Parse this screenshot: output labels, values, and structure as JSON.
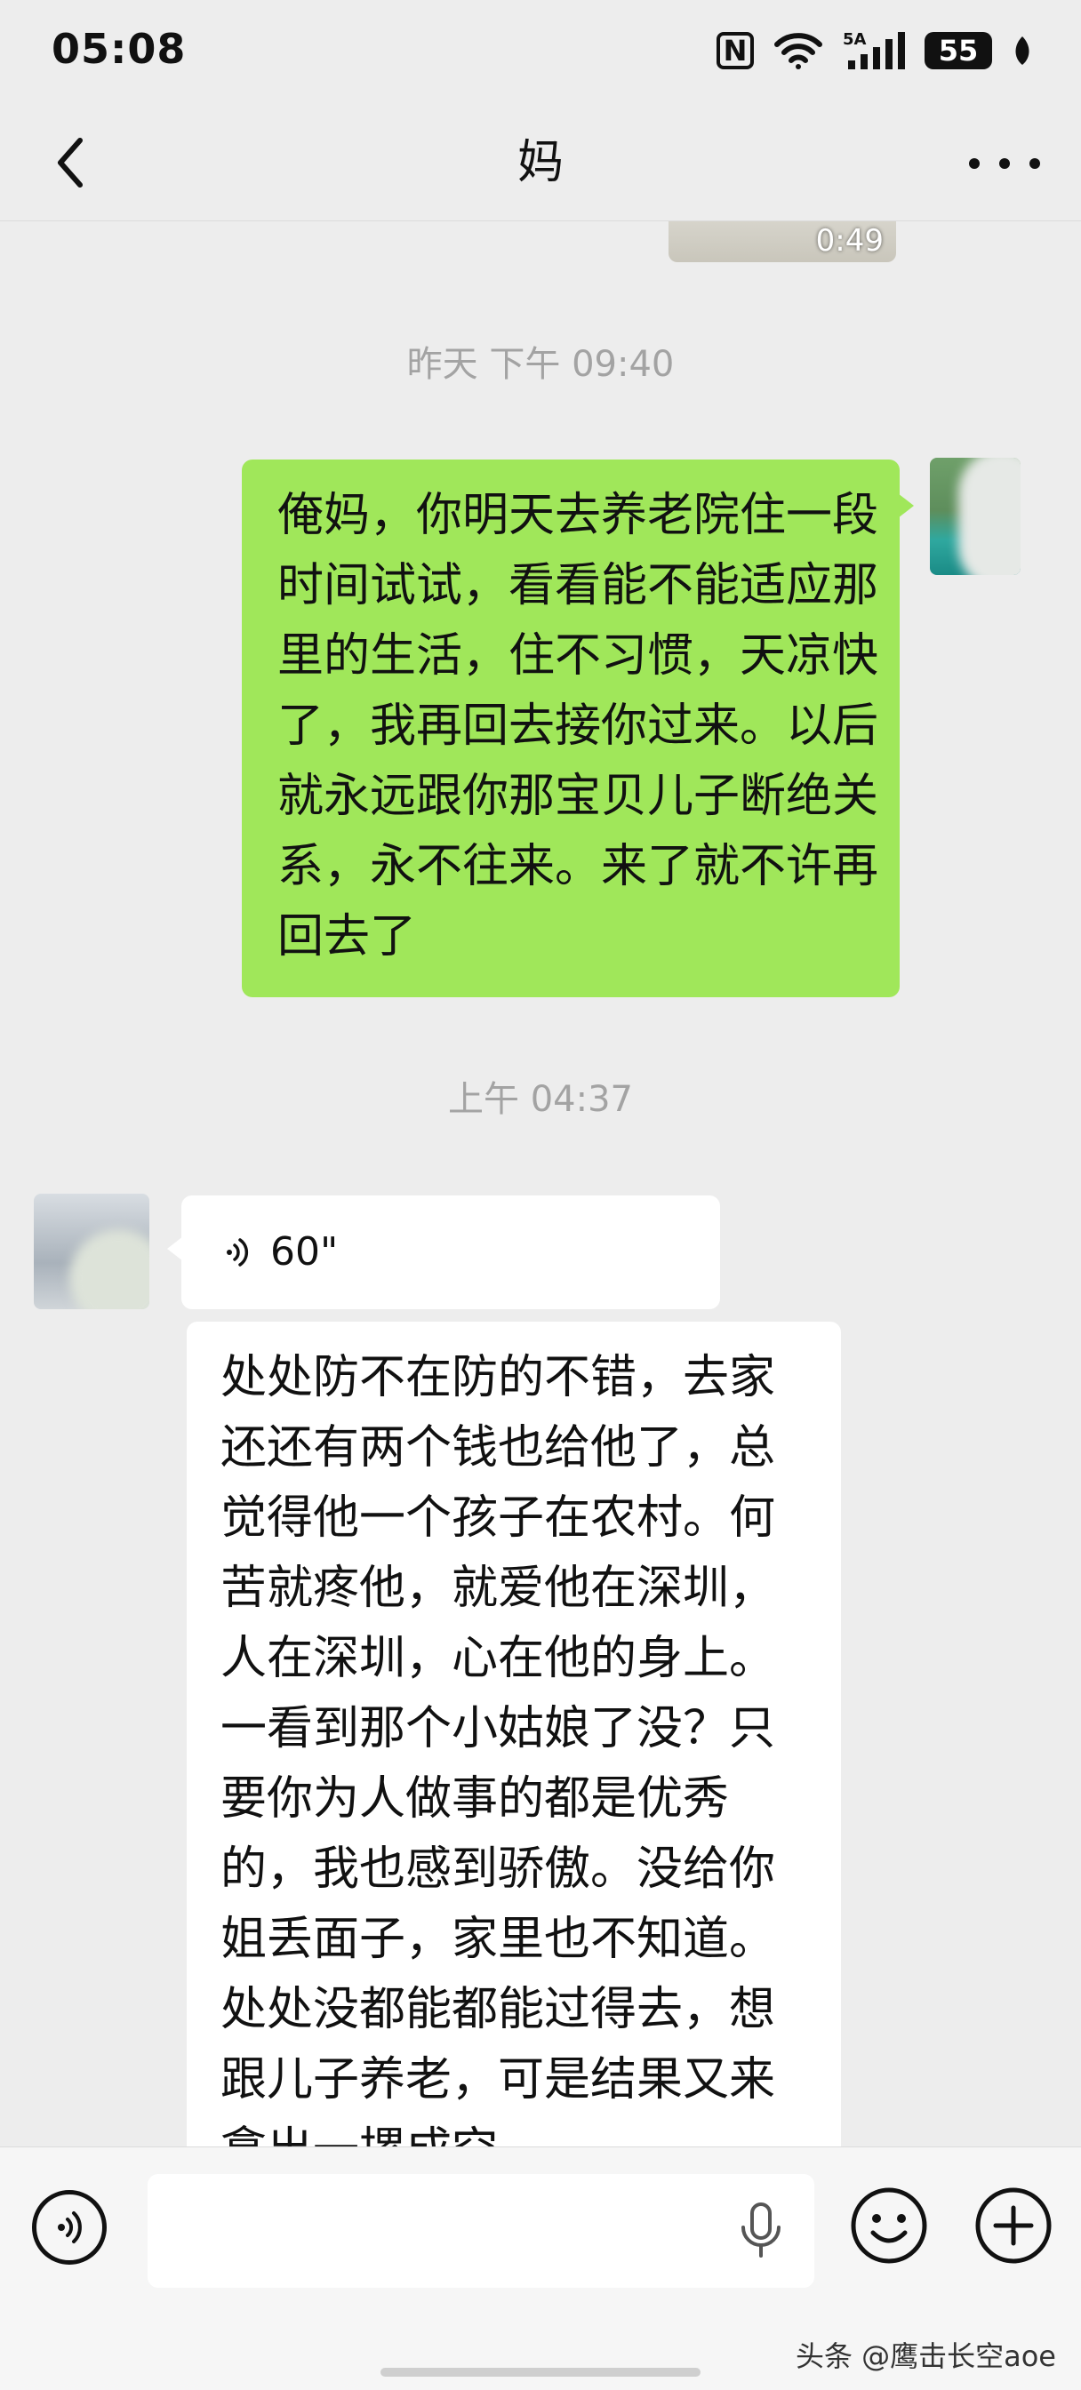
{
  "status_bar": {
    "time": "05:08",
    "nfc": "N",
    "network": "5A",
    "battery": "55"
  },
  "header": {
    "title": "妈"
  },
  "messages": {
    "video_duration": "0:49",
    "timestamp_1": "昨天 下午 09:40",
    "outgoing_text": "俺妈，你明天去养老院住一段时间试试，看看能不能适应那里的生活，住不习惯，天凉快了，我再回去接你过来。以后就永远跟你那宝贝儿子断绝关系，永不往来。来了就不许再回去了",
    "timestamp_2": "上午 04:37",
    "voice_duration": "60\"",
    "incoming_text": "处处防不在防的不错，去家还还有两个钱也给他了，总觉得他一个孩子在农村。何苦就疼他，就爱他在深圳，人在深圳，心在他的身上。一看到那个小姑娘了没？只要你为人做事的都是优秀的，我也感到骄傲。没给你姐丢面子，家里也不知道。处处没都能都能过得去，想跟儿子养老，可是结果又来拿出一摞成空。"
  },
  "input_bar": {
    "watermark": "头条 @鹰击长空aoe"
  },
  "colors": {
    "background": "#ededed",
    "outgoing_bubble": "#a0e75a",
    "incoming_bubble": "#ffffff",
    "timestamp": "#a3a3a3"
  },
  "icons": [
    "back-arrow-icon",
    "more-dots-icon",
    "voice-wave-icon",
    "voice-toggle-icon",
    "mic-icon",
    "emoji-icon",
    "plus-icon",
    "wifi-icon",
    "signal-icon",
    "nfc-icon",
    "battery-icon",
    "leaf-icon"
  ]
}
